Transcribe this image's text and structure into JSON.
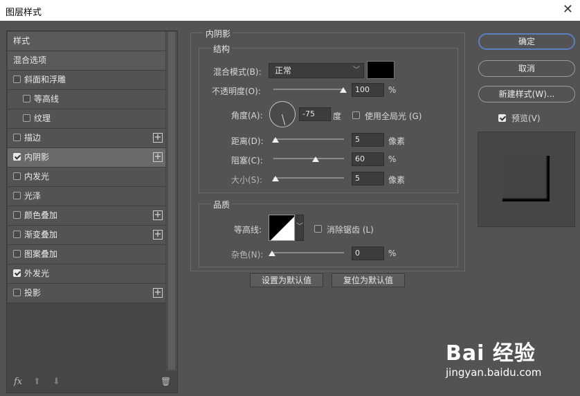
{
  "window": {
    "title": "图层样式",
    "close_glyph": "✕"
  },
  "styles_list": [
    {
      "label": "样式",
      "type": "header"
    },
    {
      "label": "混合选项",
      "type": "header"
    },
    {
      "label": "斜面和浮雕",
      "checked": false,
      "indent": false,
      "plus": false
    },
    {
      "label": "等高线",
      "checked": false,
      "indent": true,
      "plus": false
    },
    {
      "label": "纹理",
      "checked": false,
      "indent": true,
      "plus": false
    },
    {
      "label": "描边",
      "checked": false,
      "indent": false,
      "plus": true
    },
    {
      "label": "内阴影",
      "checked": true,
      "indent": false,
      "plus": true,
      "selected": true
    },
    {
      "label": "内发光",
      "checked": false,
      "indent": false,
      "plus": false
    },
    {
      "label": "光泽",
      "checked": false,
      "indent": false,
      "plus": false
    },
    {
      "label": "颜色叠加",
      "checked": false,
      "indent": false,
      "plus": true
    },
    {
      "label": "渐变叠加",
      "checked": false,
      "indent": false,
      "plus": true
    },
    {
      "label": "图案叠加",
      "checked": false,
      "indent": false,
      "plus": false
    },
    {
      "label": "外发光",
      "checked": true,
      "indent": false,
      "plus": false
    },
    {
      "label": "投影",
      "checked": false,
      "indent": false,
      "plus": true
    }
  ],
  "left_footer": {
    "fx": "fx",
    "up": "⬆",
    "down": "⬇",
    "trash": "🗑"
  },
  "inner_shadow": {
    "section_title": "内阴影",
    "structure": {
      "title": "结构",
      "blend_mode_label": "混合模式(B):",
      "blend_mode_value": "正常",
      "shadow_color": "#000000",
      "opacity_label": "不透明度(O):",
      "opacity_value": "100",
      "opacity_unit": "%",
      "angle_label": "角度(A):",
      "angle_value": "-75",
      "angle_unit": "度",
      "global_light_label": "使用全局光 (G)",
      "global_light_checked": false,
      "distance_label": "距离(D):",
      "distance_value": "5",
      "distance_unit": "像素",
      "choke_label": "阻塞(C):",
      "choke_value": "60",
      "choke_unit": "%",
      "size_label": "大小(S):",
      "size_value": "5",
      "size_unit": "像素"
    },
    "quality": {
      "title": "品质",
      "contour_label": "等高线:",
      "antialias_label": "消除锯齿 (L)",
      "antialias_checked": false,
      "noise_label": "杂色(N):",
      "noise_value": "0",
      "noise_unit": "%"
    },
    "make_default_label": "设置为默认值",
    "reset_default_label": "复位为默认值"
  },
  "buttons": {
    "ok": "确定",
    "cancel": "取消",
    "new_style": "新建样式(W)...",
    "preview_label": "预览(V)",
    "preview_checked": true
  },
  "watermark": {
    "main": "Bai 经验",
    "url": "jingyan.baidu.com"
  },
  "colors": {
    "accent": "#5c7fbf",
    "panel": "#535353"
  }
}
